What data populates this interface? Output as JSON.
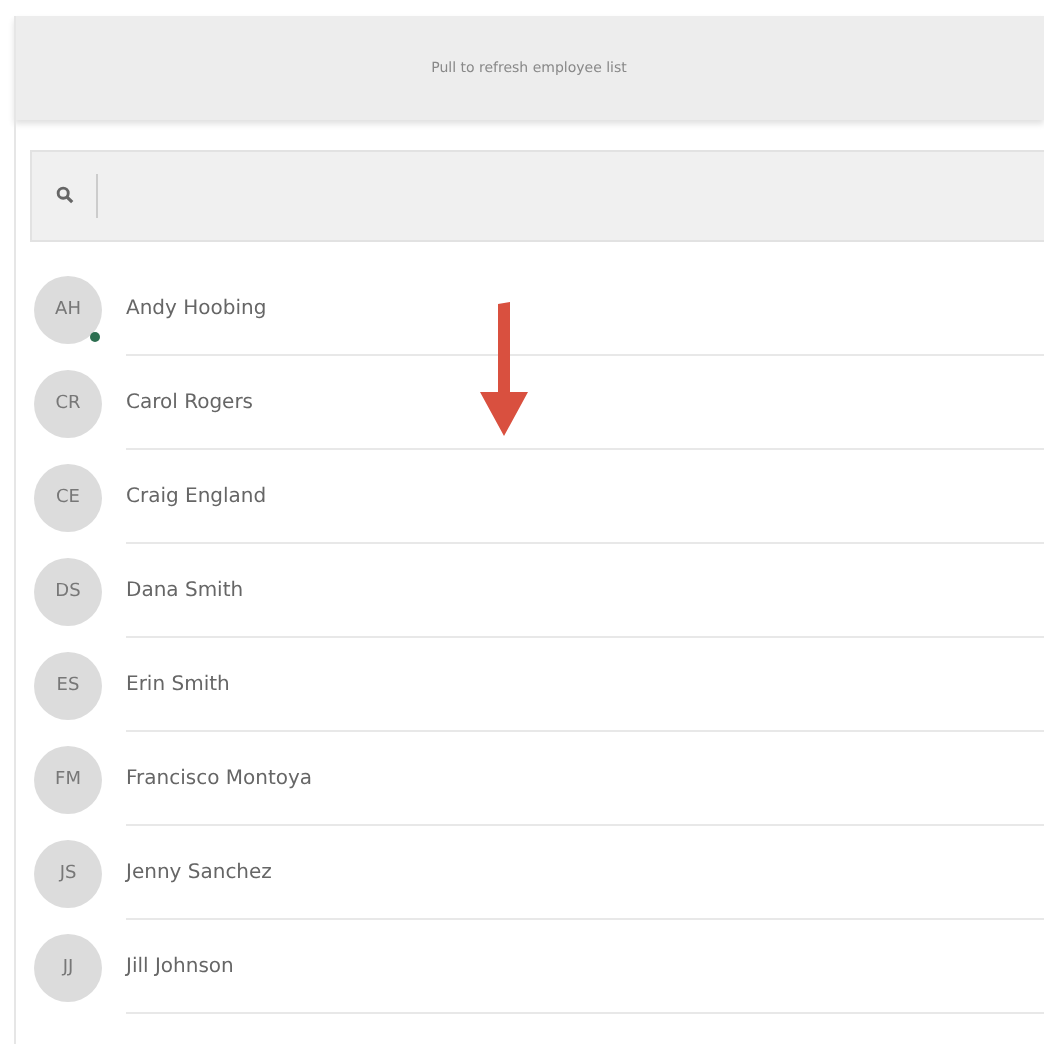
{
  "banner": {
    "text": "Pull to refresh employee list"
  },
  "employees": [
    {
      "initials": "AH",
      "name": "Andy Hoobing",
      "online": true
    },
    {
      "initials": "CR",
      "name": "Carol Rogers",
      "online": false
    },
    {
      "initials": "CE",
      "name": "Craig England",
      "online": false
    },
    {
      "initials": "DS",
      "name": "Dana Smith",
      "online": false
    },
    {
      "initials": "ES",
      "name": "Erin Smith",
      "online": false
    },
    {
      "initials": "FM",
      "name": "Francisco Montoya",
      "online": false
    },
    {
      "initials": "JS",
      "name": "Jenny Sanchez",
      "online": false
    },
    {
      "initials": "JJ",
      "name": "Jill Johnson",
      "online": false
    }
  ]
}
